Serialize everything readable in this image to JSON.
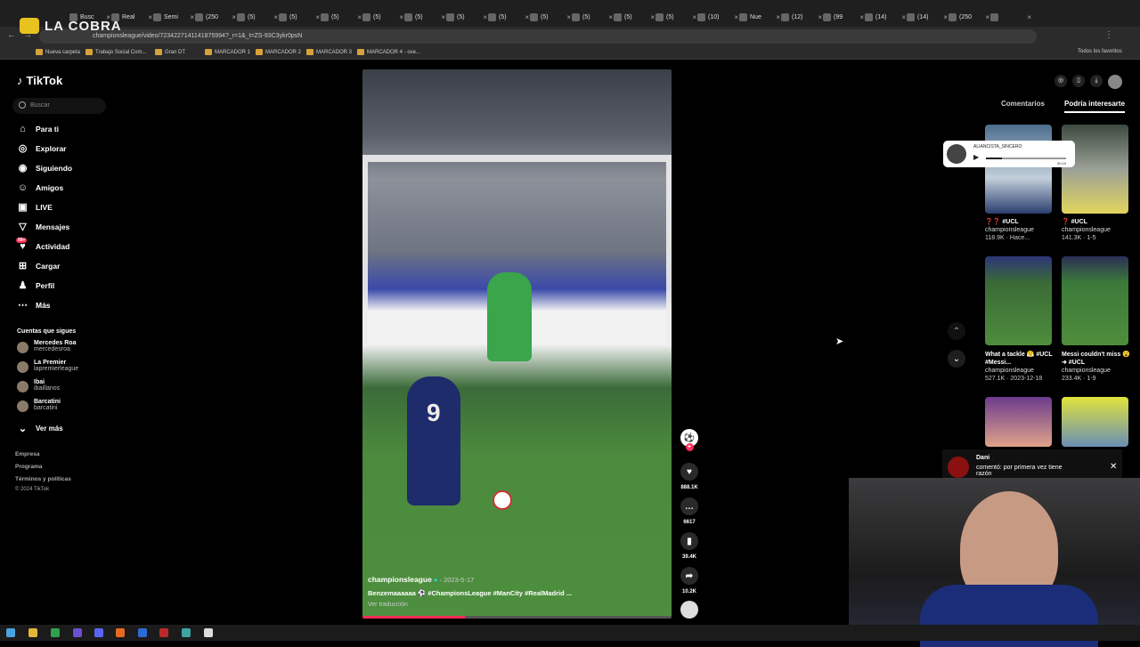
{
  "browser": {
    "url": "championsleague/video/7234227141141875994?_r=1&_t=ZS-93C3ykr0psN",
    "tabs": [
      "Busc",
      "Real",
      "Semi",
      "(250",
      "(5) ",
      "(5) ",
      "(5) ",
      "(5) ",
      "(5) ",
      "(5) ",
      "(5) ",
      "(5) ",
      "(5) ",
      "(5) ",
      "(5) ",
      "(10)",
      "Nue",
      "(12)",
      "(99",
      "(14)",
      "(14)",
      "(250",
      ""
    ],
    "bookmarks": [
      "Nueva carpeta",
      "Trabajo Social Com...",
      "Gran DT",
      "MARCADOR 1",
      "MARCADOR 2",
      "MARCADOR 3",
      "MARCADOR 4 - ove..."
    ],
    "all_bookmarks": "Todos los favoritos"
  },
  "overlay": {
    "channel_logo_text": "LA COBRA"
  },
  "sidebar": {
    "logo": "TikTok",
    "search_placeholder": "Buscar",
    "nav": [
      {
        "label": "Para ti",
        "icon": "home-icon"
      },
      {
        "label": "Explorar",
        "icon": "compass-icon"
      },
      {
        "label": "Siguiendo",
        "icon": "following-icon"
      },
      {
        "label": "Amigos",
        "icon": "friends-icon"
      },
      {
        "label": "LIVE",
        "icon": "live-icon"
      },
      {
        "label": "Mensajes",
        "icon": "messages-icon"
      },
      {
        "label": "Actividad",
        "icon": "activity-icon"
      },
      {
        "label": "Cargar",
        "icon": "upload-icon"
      },
      {
        "label": "Perfil",
        "icon": "profile-icon"
      },
      {
        "label": "Más",
        "icon": "more-icon"
      }
    ],
    "activity_badge": "99+",
    "following_title": "Cuentas que sigues",
    "following": [
      {
        "name": "Mercedes Roa",
        "handle": "mercedesroa"
      },
      {
        "name": "La Premier",
        "handle": "lapremierleague"
      },
      {
        "name": "Ibai",
        "handle": "ibaillanos"
      },
      {
        "name": "Barcatini",
        "handle": "barcatini"
      }
    ],
    "see_more": "Ver más",
    "footer": [
      "Empresa",
      "Programa",
      "Términos y políticas",
      "© 2024 TikTok"
    ]
  },
  "video": {
    "account": "championsleague",
    "date": "2023-5-17",
    "caption": "Benzemaaaaaa ⚽ #ChampionsLeague #ManCity #RealMadrid ...",
    "translate": "Ver traducción",
    "shirt_number": "9",
    "progress": 0.33
  },
  "actions": {
    "likes": "888.1K",
    "comments": "6617",
    "saves": "39.4K",
    "shares": "10.2K"
  },
  "right_panel": {
    "tabs": [
      "Comentarios",
      "Podría interesarte"
    ],
    "active_tab": "Podría interesarte",
    "videos": [
      {
        "title": "❓❓ #UCL",
        "account": "championsleague",
        "stat": "118.9K · Hace..."
      },
      {
        "title": "❓ #UCL",
        "account": "championsleague",
        "stat": "141.3K · 1-5"
      },
      {
        "title": "What a tackle 😤 #UCL #Messi...",
        "account": "championsleague",
        "stat": "527.1K · 2023-12-18"
      },
      {
        "title": "Messi couldn't miss 😮 ➜ #UCL",
        "account": "championsleague",
        "stat": "233.4K · 1-9"
      }
    ]
  },
  "audio_widget": {
    "user": "ALIANCISTA_SINCERO",
    "time": "00:19"
  },
  "notification": {
    "user": "Dani",
    "text": "comentó: por primera vez tiene razón"
  },
  "colors": {
    "accent": "#fe2c55",
    "verified": "#20d5ec",
    "bg": "#000000"
  }
}
